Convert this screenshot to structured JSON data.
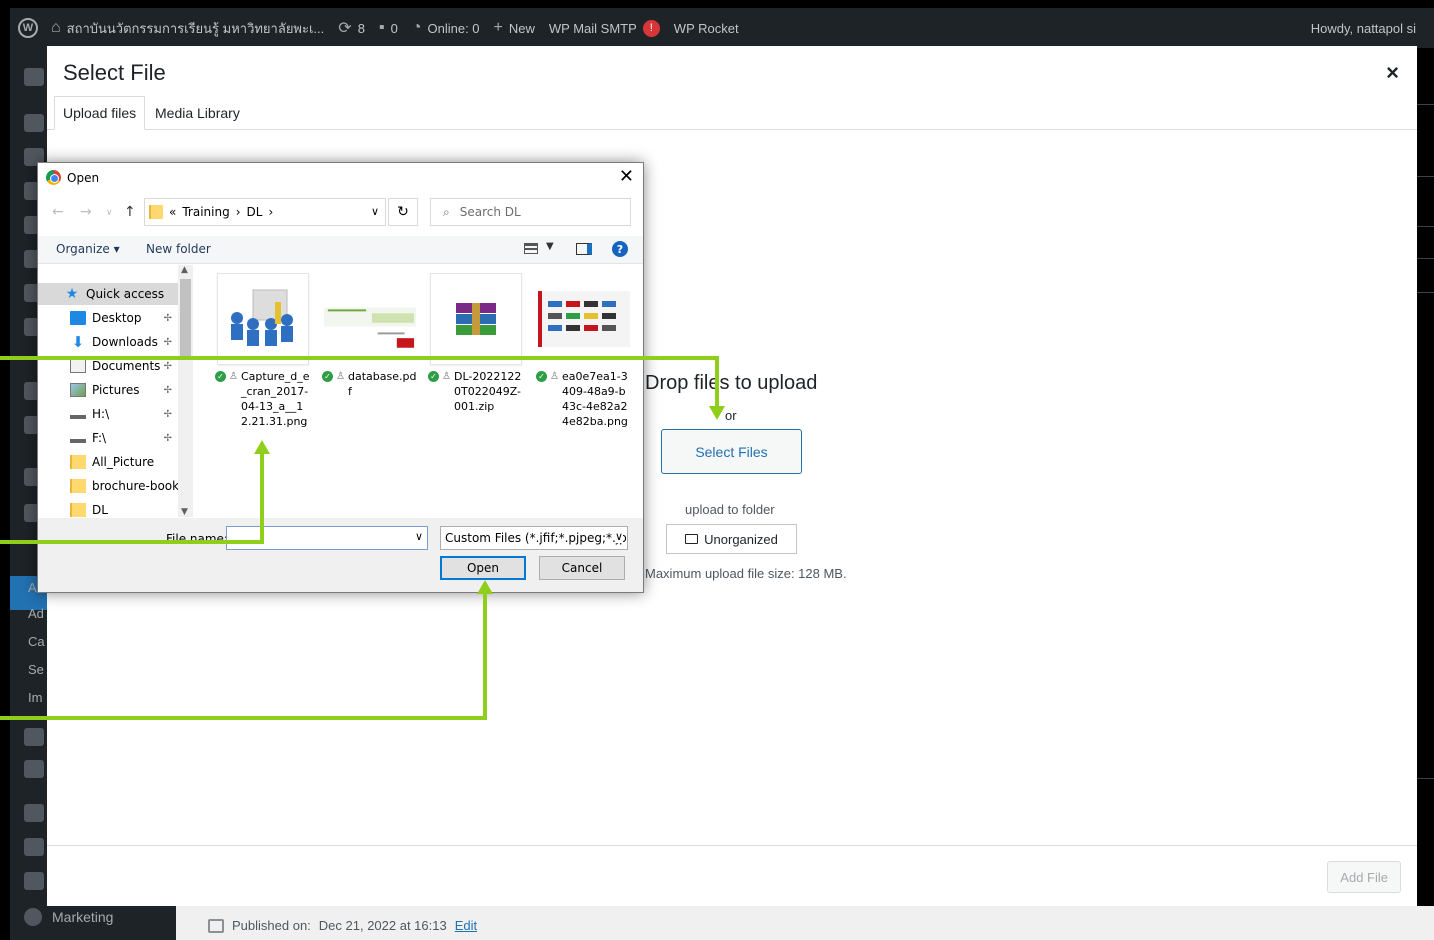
{
  "adminbar": {
    "site_name": "สถาบันนวัตกรรมการเรียนรู้ มหาวิทยาลัยพะเ...",
    "updates_count": "8",
    "comments_count": "0",
    "online": "Online: 0",
    "new_label": "New",
    "wp_mail": "WP Mail SMTP",
    "wp_mail_badge": "!",
    "wp_rocket": "WP Rocket",
    "howdy": "Howdy, nattapol si"
  },
  "sidebar": {
    "marketing": "Marketing",
    "partial_items": [
      "A",
      "Ad",
      "Ca",
      "Se",
      "Im"
    ]
  },
  "post": {
    "published_prefix": "Published on:",
    "published_date": "Dec 21, 2022 at 16:13",
    "edit_link": "Edit"
  },
  "modal": {
    "title": "Select File",
    "close": "×",
    "tabs": [
      "Upload files",
      "Media Library"
    ],
    "drop_text": "Drop files to upload",
    "or_text": "or",
    "select_files": "Select Files",
    "upload_folder_label": "upload to folder",
    "folder_name": "Unorganized",
    "max_size": "Maximum upload file size: 128 MB.",
    "add_file": "Add File"
  },
  "dialog": {
    "title": "Open",
    "close": "✕",
    "breadcrumb": [
      "«",
      "Training",
      "›",
      "DL",
      "›"
    ],
    "search_placeholder": "Search DL",
    "organize": "Organize ▾",
    "new_folder": "New folder",
    "help": "?",
    "nav_items": [
      {
        "label": "Quick access",
        "icon": "star-icon",
        "pinned": false,
        "selected": true
      },
      {
        "label": "Desktop",
        "icon": "desktop-icon",
        "pinned": true
      },
      {
        "label": "Downloads",
        "icon": "download-icon",
        "pinned": true
      },
      {
        "label": "Documents",
        "icon": "documents-icon",
        "pinned": true
      },
      {
        "label": "Pictures",
        "icon": "pictures-icon",
        "pinned": true
      },
      {
        "label": "H:\\",
        "icon": "drive-icon",
        "pinned": true
      },
      {
        "label": "F:\\",
        "icon": "drive-icon",
        "pinned": true
      },
      {
        "label": "All_Picture",
        "icon": "folder-icon",
        "pinned": false
      },
      {
        "label": "brochure-bookle",
        "icon": "folder-icon",
        "pinned": false
      },
      {
        "label": "DL",
        "icon": "folder-icon",
        "pinned": false
      }
    ],
    "files": [
      {
        "name": "Capture_d_e_cran_2017-04-13_a__12.21.31.png"
      },
      {
        "name": "database.pdf"
      },
      {
        "name": "DL-20221220T022049Z-001.zip"
      },
      {
        "name": "ea0e7ea1-3409-48a9-b43c-4e82a24e82ba.png"
      }
    ],
    "file_name_label": "File name:",
    "file_name_value": "",
    "file_type": "Custom Files (*.jfif;*.pjpeg;*.jpe",
    "open_button": "Open",
    "cancel_button": "Cancel"
  },
  "colors": {
    "wp_dark": "#1d2327",
    "wp_blue": "#2271b1",
    "annotation_green": "#8fcf1b"
  }
}
